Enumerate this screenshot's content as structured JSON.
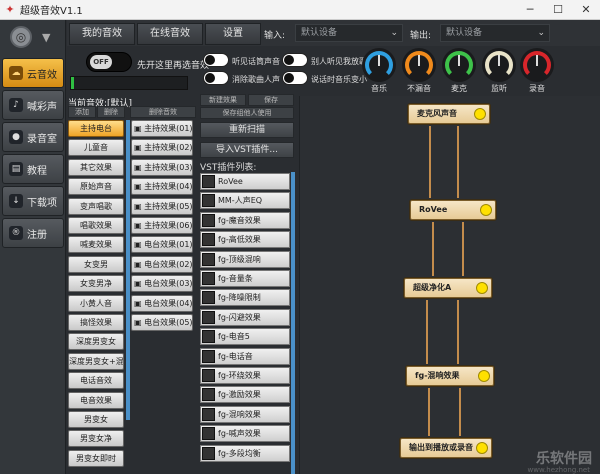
{
  "window": {
    "title": "超级音效V1.1",
    "min": "─",
    "max": "☐",
    "close": "✕"
  },
  "nav": [
    {
      "label": "云音效",
      "icon": "cloud-icon",
      "glyph": "☁"
    },
    {
      "label": "喊彩声",
      "icon": "mic-icon",
      "glyph": "♪"
    },
    {
      "label": "录音室",
      "icon": "microphone-icon",
      "glyph": "●"
    },
    {
      "label": "教程",
      "icon": "book-icon",
      "glyph": "▤"
    },
    {
      "label": "下载项",
      "icon": "download-icon",
      "glyph": "↓"
    },
    {
      "label": "注册",
      "icon": "register-icon",
      "glyph": "®"
    }
  ],
  "tabs": [
    "我的音效",
    "在线音效",
    "设置"
  ],
  "io": {
    "input_label": "输入:",
    "input_value": "默认设备",
    "output_label": "输出:",
    "output_value": "默认设备"
  },
  "controls": {
    "switch_text": "OFF",
    "switch_hint": "先开这里再选音效",
    "toggles": [
      "听见话筒声音",
      "消除歌曲人声",
      "别人听见我放歌",
      "说话时音乐变小"
    ]
  },
  "knobs": [
    {
      "label": "音乐",
      "color": "#2f9fe0"
    },
    {
      "label": "不漏音",
      "color": "#f08a1c"
    },
    {
      "label": "麦克",
      "color": "#3ec24a"
    },
    {
      "label": "监听",
      "color": "#e9e3c8"
    },
    {
      "label": "录音",
      "color": "#d8262b"
    }
  ],
  "current": {
    "title": "当前音效:[默认]",
    "add": "添加",
    "delete": "删除",
    "delete_effect": "删除音效",
    "new_effect": "新建效果",
    "save": "保存",
    "save_unused": "保存组他人使用",
    "rescan": "重新扫描",
    "import_vst": "导入VST插件...",
    "vst_title": "VST插件列表:"
  },
  "presets": [
    "主持电台",
    "儿童音",
    "其它效果",
    "原始声音",
    "变声唱歌",
    "唱歌效果",
    "喊麦效果",
    "女变男",
    "女变男净",
    "小黄人音",
    "搞怪效果",
    "深度男变女",
    "深度男变女+混响",
    "电话音效",
    "电音效果",
    "男变女",
    "男变女净",
    "男变女即时"
  ],
  "effects": [
    "主持效果(01)",
    "主持效果(02)",
    "主持效果(03)",
    "主持效果(04)",
    "主持效果(05)",
    "主持效果(06)",
    "电台效果(01)",
    "电台效果(02)",
    "电台效果(03)",
    "电台效果(04)",
    "电台效果(05)"
  ],
  "vst": [
    "RoVee",
    "MM-人声EQ",
    "fg-魔音效果",
    "fg-高低效果",
    "fg-顶级混响",
    "fg-音量条",
    "fg-降噪限制",
    "fg-闪避效果",
    "fg-电音5",
    "fg-电话音",
    "fg-环绕效果",
    "fg-激励效果",
    "fg-混响效果",
    "fg-喊声效果",
    "fg-多段均衡"
  ],
  "graph": [
    "麦克风声音",
    "RoVee",
    "超级净化A",
    "fg-混响效果",
    "输出到播放或录音"
  ],
  "watermark": {
    "main": "乐软件园",
    "sub": "www.hezhong.net"
  }
}
